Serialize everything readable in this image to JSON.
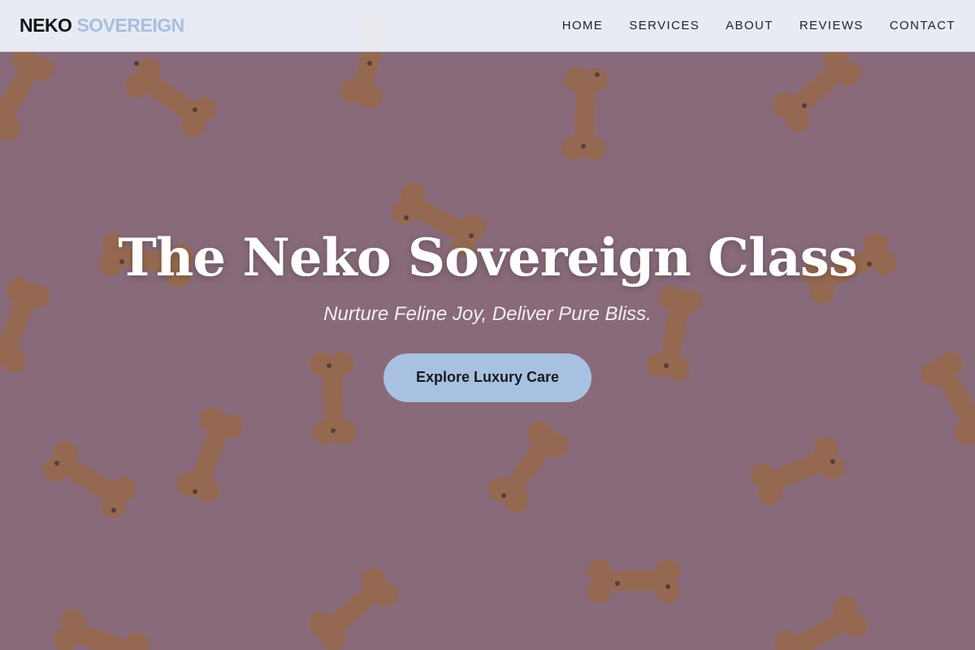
{
  "brand": {
    "part1": "NEKO",
    "part2": "SOVEREIGN"
  },
  "nav": {
    "items": [
      {
        "label": "HOME"
      },
      {
        "label": "SERVICES"
      },
      {
        "label": "ABOUT"
      },
      {
        "label": "REVIEWS"
      },
      {
        "label": "CONTACT"
      }
    ]
  },
  "hero": {
    "title": "The Neko Sovereign Class",
    "subtitle": "Nurture Feline Joy, Deliver Pure Bliss.",
    "cta_label": "Explore Luxury Care"
  },
  "colors": {
    "accent": "#a9c1e0",
    "brand_secondary": "#a7bfde",
    "navbar_bg": "#ecf1f8",
    "hero_bg": "#b08a96",
    "biscuit": "#c8894f"
  },
  "background_image": {
    "subject": "bone-shaped dog biscuits on pink surface"
  }
}
